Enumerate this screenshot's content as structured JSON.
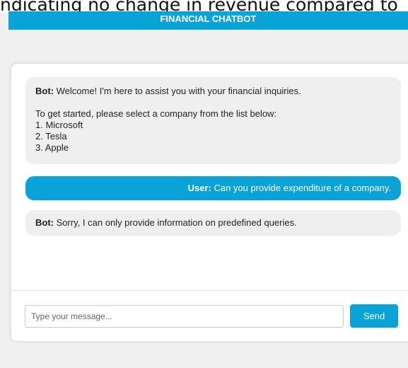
{
  "top_fragment": "ndicating no change in revenue compared to",
  "header": {
    "title": "FINANCIAL CHATBOT"
  },
  "messages": [
    {
      "sender": "Bot:",
      "text": " Welcome! I'm here to assist you with your financial inquiries.",
      "intro": "To get started, please select a company from the list below:",
      "options": [
        "1. Microsoft",
        "2. Tesla",
        "3. Apple"
      ]
    },
    {
      "sender": "User:",
      "text": " Can you provide expenditure of a company."
    },
    {
      "sender": "Bot:",
      "text": " Sorry, I can only provide information on predefined queries."
    }
  ],
  "input": {
    "placeholder": "Type your message...",
    "value": ""
  },
  "send_label": "Send",
  "colors": {
    "accent": "#0aa3d7",
    "bot_bubble": "#efefef",
    "page_background": "#f0f0f0"
  }
}
